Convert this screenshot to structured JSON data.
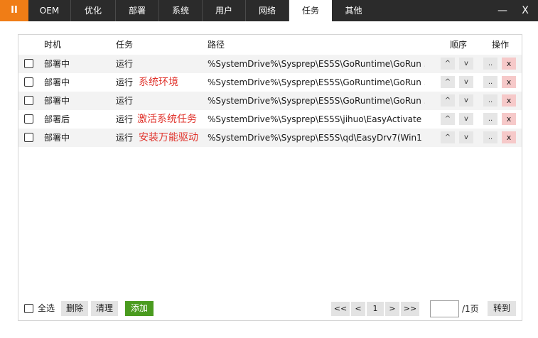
{
  "topbar": {
    "logo": "II",
    "tabs": [
      {
        "label": "OEM"
      },
      {
        "label": "优化"
      },
      {
        "label": "部署"
      },
      {
        "label": "系统"
      },
      {
        "label": "用户"
      },
      {
        "label": "网络"
      },
      {
        "label": "任务"
      },
      {
        "label": "其他"
      }
    ],
    "active_tab": "任务",
    "minimize": "—",
    "close": "X"
  },
  "table": {
    "headers": {
      "timing": "时机",
      "task": "任务",
      "path": "路径",
      "order": "顺序",
      "ops": "操作"
    },
    "rows": [
      {
        "timing": "部署中",
        "task": "运行",
        "note": "",
        "path": "%SystemDrive%\\Sysprep\\ES5S\\GoRuntime\\GoRun ..",
        "up": "^",
        "down": "v",
        "edit": "..",
        "del": "x"
      },
      {
        "timing": "部署中",
        "task": "运行",
        "note": "系统环境",
        "path": "%SystemDrive%\\Sysprep\\ES5S\\GoRuntime\\GoRun ..",
        "up": "^",
        "down": "v",
        "edit": "..",
        "del": "x"
      },
      {
        "timing": "部署中",
        "task": "运行",
        "note": "",
        "path": "%SystemDrive%\\Sysprep\\ES5S\\GoRuntime\\GoRun ..",
        "up": "^",
        "down": "v",
        "edit": "..",
        "del": "x"
      },
      {
        "timing": "部署后",
        "task": "运行",
        "note": "激活系统任务",
        "path": "%SystemDrive%\\Sysprep\\ES5S\\jihuo\\EasyActivate ..",
        "up": "^",
        "down": "v",
        "edit": "..",
        "del": "x"
      },
      {
        "timing": "部署中",
        "task": "运行",
        "note": "安装万能驱动",
        "path": "%SystemDrive%\\Sysprep\\ES5S\\qd\\EasyDrv7(Win1 ..",
        "up": "^",
        "down": "v",
        "edit": "..",
        "del": "x"
      }
    ]
  },
  "footer": {
    "select_all": "全选",
    "delete": "删除",
    "clear": "清理",
    "add": "添加",
    "first": "<<",
    "prev": "<",
    "page": "1",
    "next": ">",
    "last": ">>",
    "page_input": "",
    "total": "/1页",
    "goto": "转到"
  },
  "colors": {
    "accent": "#f07d16",
    "topbar": "#2b2b2b",
    "add_button": "#4a9b1f",
    "note_text": "#e0332c",
    "delete_button": "#f6c9c9"
  }
}
